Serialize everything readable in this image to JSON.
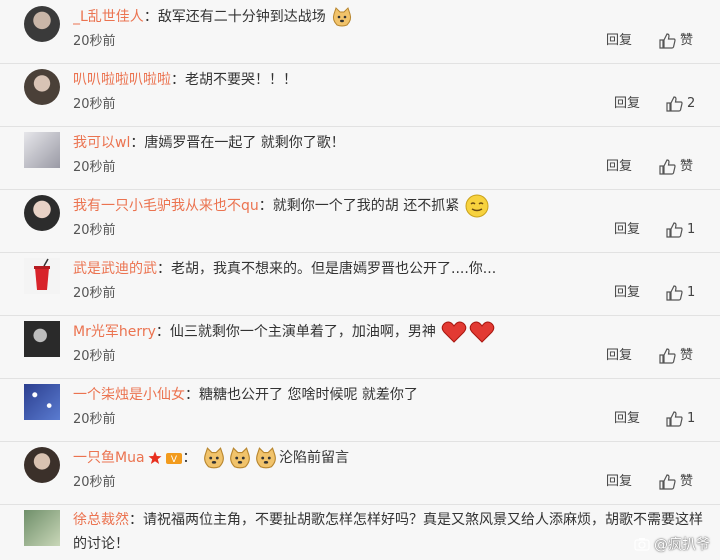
{
  "comments": [
    {
      "user": "_L乱世佳人",
      "colon": "：",
      "text": "敌军还有二十分钟到达战场",
      "emoji": [
        "doge-emoji"
      ],
      "time": "20秒前",
      "reply": "回复",
      "likes": "赞"
    },
    {
      "user": "叭叭啦啦叭啦啦",
      "colon": "：",
      "text": "老胡不要哭！！！",
      "emoji": [],
      "time": "20秒前",
      "reply": "回复",
      "likes": "2"
    },
    {
      "user": "我可以wl",
      "colon": "：",
      "text": "唐嫣罗晋在一起了 就剩你了歌！",
      "emoji": [],
      "time": "20秒前",
      "reply": "回复",
      "likes": "赞"
    },
    {
      "user": "我有一只小毛驴我从来也不qu",
      "colon": "：",
      "text": "就剩你一个了我的胡  还不抓紧",
      "emoji": [
        "smile-emoji"
      ],
      "time": "20秒前",
      "reply": "回复",
      "likes": "1"
    },
    {
      "user": "武是武迪的武",
      "colon": "：",
      "text": "老胡，我真不想来的。但是唐嫣罗晋也公开了....你...",
      "emoji": [],
      "time": "20秒前",
      "reply": "回复",
      "likes": "1"
    },
    {
      "user": "Mr光军herry",
      "colon": "：",
      "text": "仙三就剩你一个主演单着了，加油啊，男神",
      "emoji": [
        "heart-emoji",
        "heart-emoji"
      ],
      "time": "20秒前",
      "reply": "回复",
      "likes": "赞"
    },
    {
      "user": "一个柒烛是小仙女",
      "colon": "：",
      "text": "糖糖也公开了 您啥时候呢 就差你了",
      "emoji": [],
      "time": "20秒前",
      "reply": "回复",
      "likes": "1"
    },
    {
      "user": "一只鱼Mua",
      "colon": "：",
      "text": "沦陷前留言",
      "emoji": [
        "doge-emoji",
        "doge-emoji",
        "doge-emoji"
      ],
      "time": "20秒前",
      "reply": "回复",
      "likes": "赞"
    },
    {
      "user": "徐总裁然",
      "colon": "：",
      "text": "请祝福两位主角，不要扯胡歌怎样怎样好吗？真是又煞风景又给人添麻烦，胡歌不需要这样的讨论！",
      "emoji": [],
      "time": "",
      "reply": "",
      "likes": ""
    }
  ],
  "watermark": "@疯扒爷",
  "colors": {
    "username": "#eb7350",
    "text": "#333333",
    "background": "#f7f7f7"
  }
}
